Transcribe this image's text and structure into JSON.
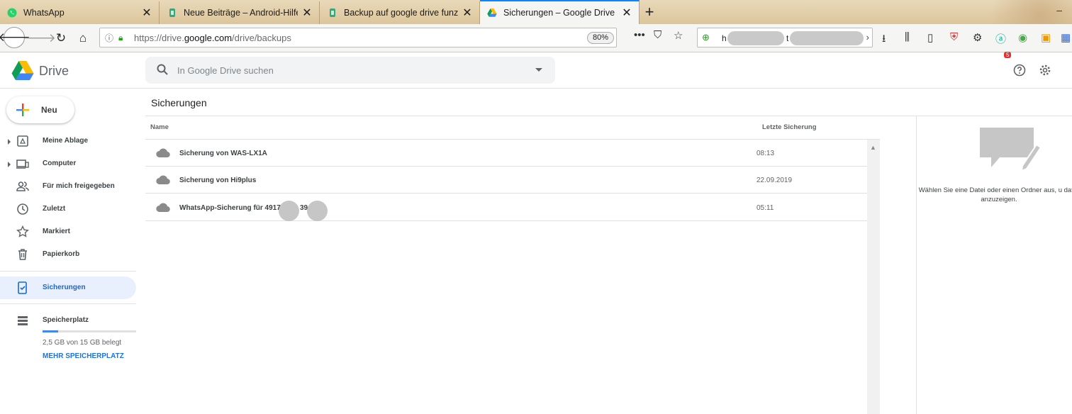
{
  "browser": {
    "tabs": [
      {
        "label": "WhatsApp",
        "icon": "whatsapp-icon"
      },
      {
        "label": "Neue Beiträge – Android-Hilfe.",
        "icon": "android-hilfe-icon"
      },
      {
        "label": "Backup auf google drive funzt r",
        "icon": "android-hilfe-icon"
      },
      {
        "label": "Sicherungen – Google Drive",
        "icon": "google-drive-icon",
        "active": true
      }
    ],
    "url_prefix": "https://drive.",
    "url_domain": "google.com",
    "url_path": "/drive/backups",
    "zoom": "80%",
    "search_visible_text": "h",
    "search_visible_text2": "t",
    "badge_count": "5"
  },
  "drive": {
    "app_name": "Drive",
    "search_placeholder": "In Google Drive suchen",
    "new_button": "Neu",
    "nav": [
      {
        "label": "Meine Ablage",
        "icon": "my-drive-icon",
        "expandable": true
      },
      {
        "label": "Computer",
        "icon": "computer-icon",
        "expandable": true
      },
      {
        "label": "Für mich freigegeben",
        "icon": "shared-icon"
      },
      {
        "label": "Zuletzt",
        "icon": "clock-icon"
      },
      {
        "label": "Markiert",
        "icon": "star-icon"
      },
      {
        "label": "Papierkorb",
        "icon": "trash-icon"
      }
    ],
    "backups_label": "Sicherungen",
    "storage_label": "Speicherplatz",
    "storage_used_fraction": 0.17,
    "storage_text": "2,5 GB von 15 GB belegt",
    "storage_link": "MEHR SPEICHERPLATZ",
    "page_title": "Sicherungen",
    "columns": {
      "name": "Name",
      "last_backup": "Letzte Sicherung"
    },
    "rows": [
      {
        "name": "Sicherung von WAS-LX1A",
        "date": "08:13"
      },
      {
        "name": "Sicherung von Hi9plus",
        "date": "22.09.2019"
      },
      {
        "name": "WhatsApp-Sicherung für 4917",
        "name_tail": "39",
        "date": "05:11"
      }
    ],
    "detail_text": "Wählen Sie eine Datei oder einen Ordner aus, u dafür anzuzeigen."
  }
}
